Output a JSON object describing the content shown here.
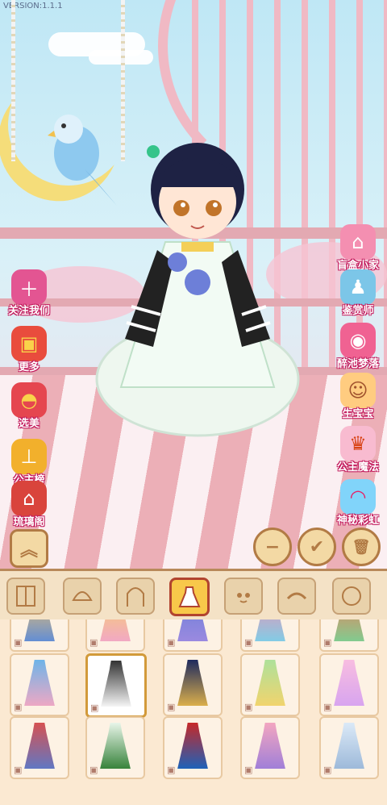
{
  "version": "VERSION:1.1.1",
  "left_menu": [
    {
      "label": "关注我们",
      "icon": "follow-us-icon",
      "color": "#e35592"
    },
    {
      "label": "更多",
      "icon": "gift-box-icon",
      "color": "#e94c3d"
    },
    {
      "label": "选美",
      "icon": "fan-icon",
      "color": "#e5464f"
    },
    {
      "label": "公主榜",
      "icon": "ranking-icon",
      "color": "#f2b02c"
    },
    {
      "label": "琉璃阁",
      "icon": "pavilion-icon",
      "color": "#d9443c"
    }
  ],
  "right_menu": [
    {
      "label": "盲盒小家",
      "icon": "blind-box-icon",
      "color": "#f48fb1"
    },
    {
      "label": "鉴赏师",
      "icon": "appraiser-icon",
      "color": "#7cc6e8"
    },
    {
      "label": "醉池梦落",
      "icon": "cat-mask-icon",
      "color": "#f06292"
    },
    {
      "label": "生宝宝",
      "icon": "baby-icon",
      "color": "#ffcc80"
    },
    {
      "label": "公主魔法",
      "icon": "princess-icon",
      "color": "#f8bbd0"
    },
    {
      "label": "神秘彩虹",
      "icon": "rainbow-icon",
      "color": "#81d4fa"
    }
  ],
  "actions": {
    "minus": "−",
    "confirm": "✔",
    "delete": "🗑"
  },
  "categories": [
    "wardrobe",
    "hair-front",
    "hair-back",
    "dress",
    "face",
    "eyebrows",
    "face-shape"
  ],
  "active_category": 3,
  "items": [
    {
      "colors": [
        "#f2c26b",
        "#5b8bd9"
      ]
    },
    {
      "colors": [
        "#f6d36b",
        "#f2a6c8"
      ]
    },
    {
      "colors": [
        "#6a7fd8",
        "#9d8ae0"
      ]
    },
    {
      "colors": [
        "#f48fb1",
        "#7ccfe8"
      ]
    },
    {
      "colors": [
        "#ef7f5a",
        "#7ccf92"
      ]
    },
    {
      "colors": [
        "#6fb4e8",
        "#f4a7c2"
      ]
    },
    {
      "colors": [
        "#333333",
        "#ffffff"
      ]
    },
    {
      "colors": [
        "#1e2a5e",
        "#e5b64a"
      ]
    },
    {
      "colors": [
        "#aee19a",
        "#f4d36b"
      ]
    },
    {
      "colors": [
        "#f8bde0",
        "#d6a3f0"
      ]
    },
    {
      "colors": [
        "#d65252",
        "#5b79c9"
      ]
    },
    {
      "colors": [
        "#e8f5e9",
        "#2e7d32"
      ]
    },
    {
      "colors": [
        "#c62828",
        "#1565c0"
      ]
    },
    {
      "colors": [
        "#f3a6c0",
        "#9c7dd9"
      ]
    },
    {
      "colors": [
        "#dbe9f7",
        "#9ab7d8"
      ]
    }
  ],
  "selected_item": 6,
  "accent": "#f8c84a",
  "frame_color": "#b8895a"
}
